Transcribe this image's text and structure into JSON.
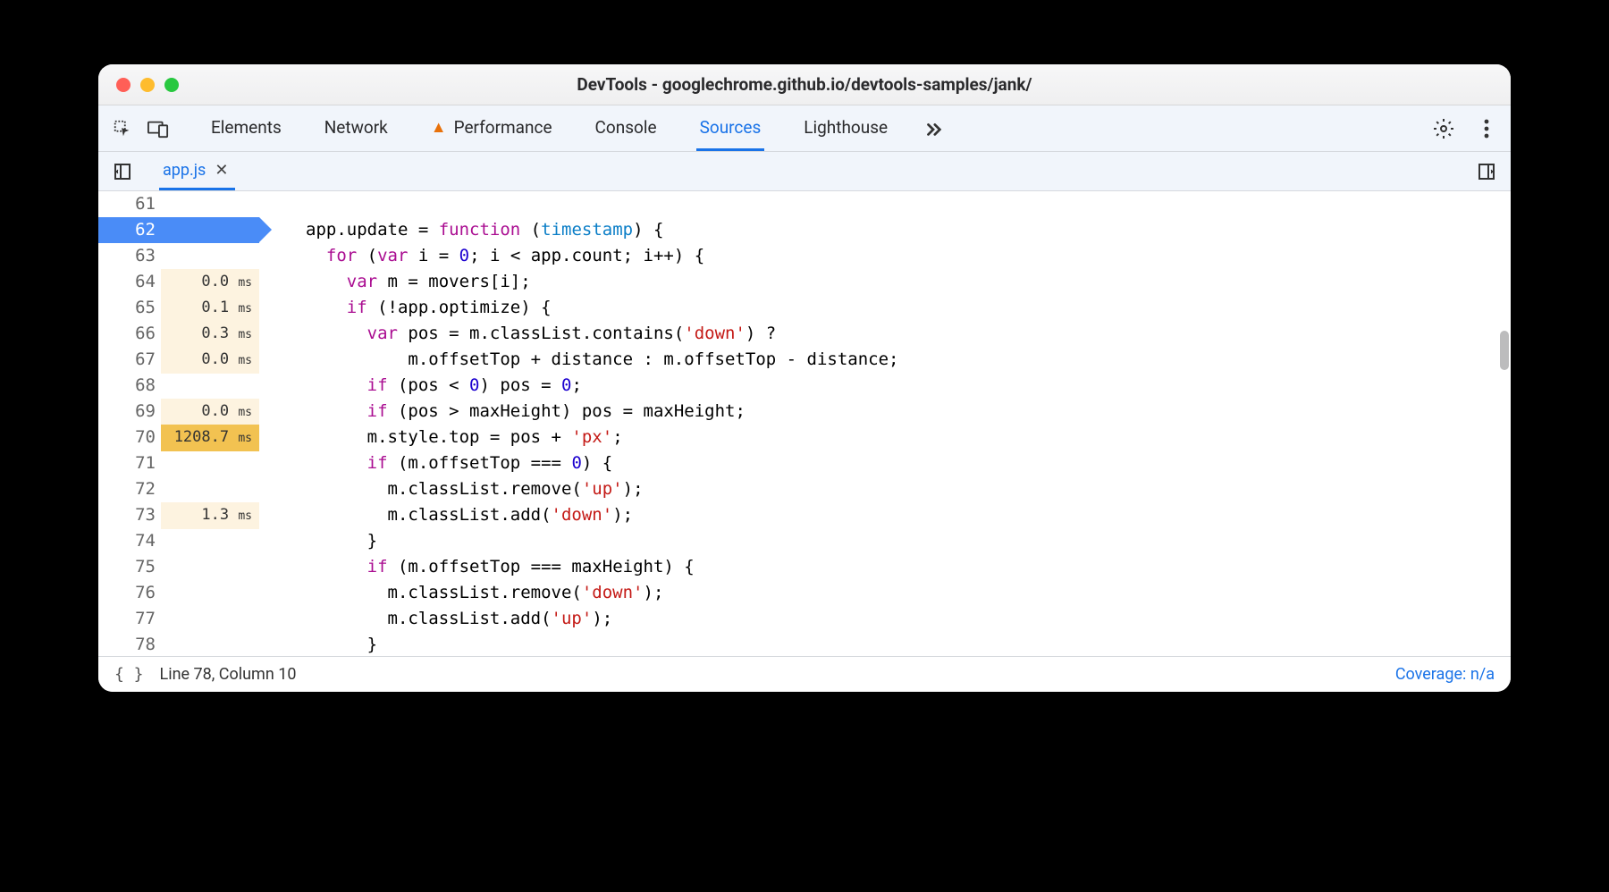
{
  "window": {
    "title": "DevTools - googlechrome.github.io/devtools-samples/jank/"
  },
  "toolbar_tabs": [
    {
      "label": "Elements",
      "active": false,
      "warn": false
    },
    {
      "label": "Network",
      "active": false,
      "warn": false
    },
    {
      "label": "Performance",
      "active": false,
      "warn": true
    },
    {
      "label": "Console",
      "active": false,
      "warn": false
    },
    {
      "label": "Sources",
      "active": true,
      "warn": false
    },
    {
      "label": "Lighthouse",
      "active": false,
      "warn": false
    }
  ],
  "file_tab": {
    "name": "app.js"
  },
  "editor": {
    "active_line": 62,
    "lines": [
      {
        "n": 61,
        "timing": null,
        "tokens": []
      },
      {
        "n": 62,
        "timing": null,
        "tokens": [
          {
            "t": "app.update = "
          },
          {
            "t": "function",
            "c": "kw"
          },
          {
            "t": " ("
          },
          {
            "t": "timestamp",
            "c": "fn"
          },
          {
            "t": ") {"
          }
        ]
      },
      {
        "n": 63,
        "timing": null,
        "tokens": [
          {
            "t": "  "
          },
          {
            "t": "for",
            "c": "kw"
          },
          {
            "t": " ("
          },
          {
            "t": "var",
            "c": "kw"
          },
          {
            "t": " i = "
          },
          {
            "t": "0",
            "c": "num"
          },
          {
            "t": "; i < app.count; i++) {"
          }
        ]
      },
      {
        "n": 64,
        "timing": "0.0",
        "heat": "light",
        "tokens": [
          {
            "t": "    "
          },
          {
            "t": "var",
            "c": "kw"
          },
          {
            "t": " m = movers[i];"
          }
        ]
      },
      {
        "n": 65,
        "timing": "0.1",
        "heat": "light",
        "tokens": [
          {
            "t": "    "
          },
          {
            "t": "if",
            "c": "kw"
          },
          {
            "t": " (!app.optimize) {"
          }
        ]
      },
      {
        "n": 66,
        "timing": "0.3",
        "heat": "light",
        "tokens": [
          {
            "t": "      "
          },
          {
            "t": "var",
            "c": "kw"
          },
          {
            "t": " pos = m.classList.contains("
          },
          {
            "t": "'down'",
            "c": "str"
          },
          {
            "t": ") ?"
          }
        ]
      },
      {
        "n": 67,
        "timing": "0.0",
        "heat": "light",
        "tokens": [
          {
            "t": "          m.offsetTop + distance : m.offsetTop - distance;"
          }
        ]
      },
      {
        "n": 68,
        "timing": null,
        "tokens": [
          {
            "t": "      "
          },
          {
            "t": "if",
            "c": "kw"
          },
          {
            "t": " (pos < "
          },
          {
            "t": "0",
            "c": "num"
          },
          {
            "t": ") pos = "
          },
          {
            "t": "0",
            "c": "num"
          },
          {
            "t": ";"
          }
        ]
      },
      {
        "n": 69,
        "timing": "0.0",
        "heat": "light",
        "tokens": [
          {
            "t": "      "
          },
          {
            "t": "if",
            "c": "kw"
          },
          {
            "t": " (pos > maxHeight) pos = maxHeight;"
          }
        ]
      },
      {
        "n": 70,
        "timing": "1208.7",
        "heat": "heavy",
        "tokens": [
          {
            "t": "      m.style.top = pos + "
          },
          {
            "t": "'px'",
            "c": "str"
          },
          {
            "t": ";"
          }
        ]
      },
      {
        "n": 71,
        "timing": null,
        "tokens": [
          {
            "t": "      "
          },
          {
            "t": "if",
            "c": "kw"
          },
          {
            "t": " (m.offsetTop === "
          },
          {
            "t": "0",
            "c": "num"
          },
          {
            "t": ") {"
          }
        ]
      },
      {
        "n": 72,
        "timing": null,
        "tokens": [
          {
            "t": "        m.classList.remove("
          },
          {
            "t": "'up'",
            "c": "str"
          },
          {
            "t": ");"
          }
        ]
      },
      {
        "n": 73,
        "timing": "1.3",
        "heat": "light",
        "tokens": [
          {
            "t": "        m.classList.add("
          },
          {
            "t": "'down'",
            "c": "str"
          },
          {
            "t": ");"
          }
        ]
      },
      {
        "n": 74,
        "timing": null,
        "tokens": [
          {
            "t": "      }"
          }
        ]
      },
      {
        "n": 75,
        "timing": null,
        "tokens": [
          {
            "t": "      "
          },
          {
            "t": "if",
            "c": "kw"
          },
          {
            "t": " (m.offsetTop === maxHeight) {"
          }
        ]
      },
      {
        "n": 76,
        "timing": null,
        "tokens": [
          {
            "t": "        m.classList.remove("
          },
          {
            "t": "'down'",
            "c": "str"
          },
          {
            "t": ");"
          }
        ]
      },
      {
        "n": 77,
        "timing": null,
        "tokens": [
          {
            "t": "        m.classList.add("
          },
          {
            "t": "'up'",
            "c": "str"
          },
          {
            "t": ");"
          }
        ]
      },
      {
        "n": 78,
        "timing": null,
        "tokens": [
          {
            "t": "      }"
          }
        ]
      }
    ],
    "timing_unit": "ms"
  },
  "statusbar": {
    "braces": "{ }",
    "cursor": "Line 78, Column 10",
    "coverage": "Coverage: n/a"
  }
}
